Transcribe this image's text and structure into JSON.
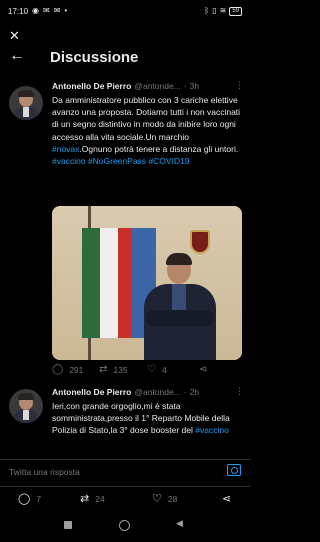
{
  "status_bar": {
    "time": "17:10",
    "left_icons": [
      "messenger-icon",
      "mail-icon",
      "mail-icon",
      "more-dots-icon"
    ],
    "right_icons": [
      "bluetooth-icon",
      "vibrate-icon",
      "wifi-icon"
    ],
    "battery": "59"
  },
  "header": {
    "title": "Discussione"
  },
  "tweets": [
    {
      "author": "Antonello De Pierro",
      "handle": "@antonde...",
      "time": "3h",
      "text_parts": [
        {
          "text": "Da amministratore pubblico con 3 cariche elettive avanzo una proposta. Dotiamo tutti i non vaccinati di un segno distintivo in modo da inibire loro ogni accesso alla vita sociale.Un marchio ",
          "tag": false
        },
        {
          "text": "#novax",
          "tag": true
        },
        {
          "text": ".Ognuno potrà tenere a distanza gli untori. ",
          "tag": false
        },
        {
          "text": "#vaccino",
          "tag": true
        },
        {
          "text": " ",
          "tag": false
        },
        {
          "text": "#NoGreenPass",
          "tag": true
        },
        {
          "text": " ",
          "tag": false
        },
        {
          "text": "#COVID19",
          "tag": true
        }
      ],
      "replies": "291",
      "retweets": "135",
      "likes": "4"
    },
    {
      "author": "Antonello De Pierro",
      "handle": "@antonde...",
      "time": "2h",
      "text_parts": [
        {
          "text": "Ieri,con grande orgoglio,mi è stata somministrata,presso il 1° Reparto Mobile della Polizia di Stato,la 3° dose booster del ",
          "tag": false
        },
        {
          "text": "#vaccino",
          "tag": true
        }
      ]
    }
  ],
  "reply_bar": {
    "placeholder": "Twitta una risposta"
  },
  "bottom_actions": {
    "replies": "7",
    "retweets": "24",
    "likes": "28"
  },
  "colors": {
    "background": "#000000",
    "text": "#e7e9ea",
    "muted": "#71767b",
    "accent": "#1d9bf0"
  }
}
